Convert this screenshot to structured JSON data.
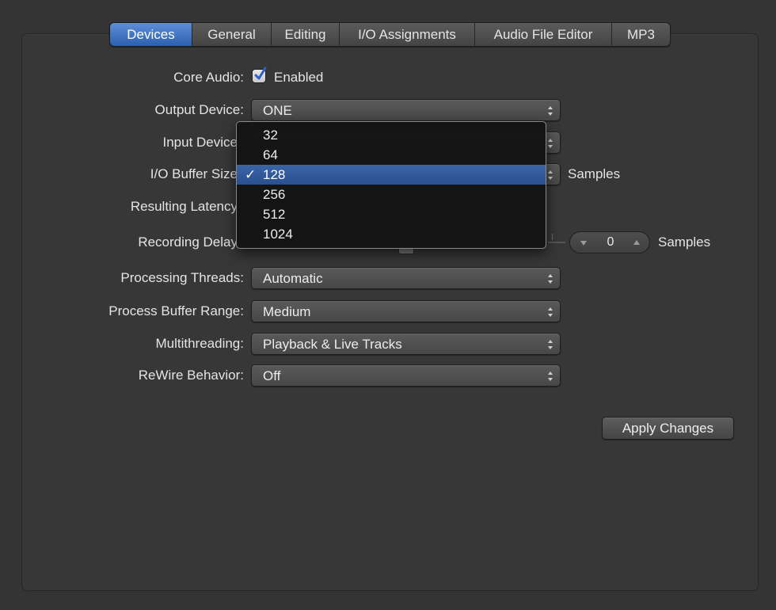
{
  "tabs": [
    {
      "label": "Devices",
      "active": true
    },
    {
      "label": "General"
    },
    {
      "label": "Editing"
    },
    {
      "label": "I/O Assignments"
    },
    {
      "label": "Audio File Editor"
    },
    {
      "label": "MP3"
    }
  ],
  "core_audio": {
    "label": "Core Audio:",
    "checkbox_label": "Enabled",
    "checked": true
  },
  "output_device": {
    "label": "Output Device:",
    "value": "ONE"
  },
  "input_device": {
    "label": "Input Device"
  },
  "io_buffer": {
    "label": "I/O Buffer Size",
    "unit": "Samples"
  },
  "resulting_latency": {
    "label": "Resulting Latency"
  },
  "recording_delay": {
    "label": "Recording Delay",
    "value": "0",
    "unit": "Samples"
  },
  "processing_threads": {
    "label": "Processing Threads:",
    "value": "Automatic"
  },
  "process_buffer_range": {
    "label": "Process Buffer Range:",
    "value": "Medium"
  },
  "multithreading": {
    "label": "Multithreading:",
    "value": "Playback & Live Tracks"
  },
  "rewire": {
    "label": "ReWire Behavior:",
    "value": "Off"
  },
  "apply_button": {
    "label": "Apply Changes"
  },
  "buffer_menu": {
    "items": [
      "32",
      "64",
      "128",
      "256",
      "512",
      "1024"
    ],
    "selected": "128",
    "check_glyph": "✓"
  },
  "colors": {
    "accent": "#2f5fae",
    "background": "#343434"
  }
}
